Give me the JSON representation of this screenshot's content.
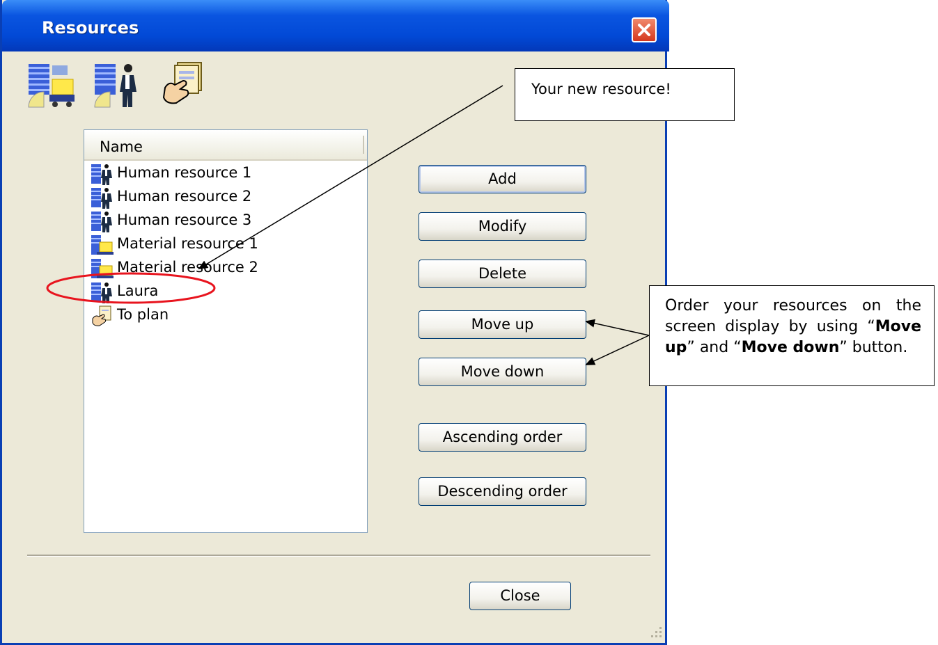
{
  "window": {
    "title": "Resources",
    "close_glyph": "✕"
  },
  "toolbar": {
    "icons": [
      "material-resource-icon",
      "human-resource-icon",
      "to-plan-icon"
    ]
  },
  "list": {
    "column_header": "Name",
    "items": [
      {
        "label": "Human resource 1",
        "icon": "human-resource-icon"
      },
      {
        "label": "Human resource 2",
        "icon": "human-resource-icon"
      },
      {
        "label": "Human resource 3",
        "icon": "human-resource-icon"
      },
      {
        "label": "Material resource 1",
        "icon": "material-resource-icon"
      },
      {
        "label": "Material resource 2",
        "icon": "material-resource-icon"
      },
      {
        "label": "Laura",
        "icon": "human-resource-icon"
      },
      {
        "label": "To plan",
        "icon": "to-plan-icon"
      }
    ]
  },
  "buttons": {
    "add": "Add",
    "modify": "Modify",
    "delete": "Delete",
    "move_up": "Move up",
    "move_down": "Move down",
    "ascending": "Ascending order",
    "descending": "Descending order",
    "close": "Close"
  },
  "annotations": {
    "new_resource": "Your new resource!",
    "order_text_1": "Order your resources on the screen display by using “",
    "order_bold_1": "Move up",
    "order_text_2": "” and “",
    "order_bold_2": "Move down",
    "order_text_3": "” button.",
    "highlight_color": "#e8141e"
  }
}
